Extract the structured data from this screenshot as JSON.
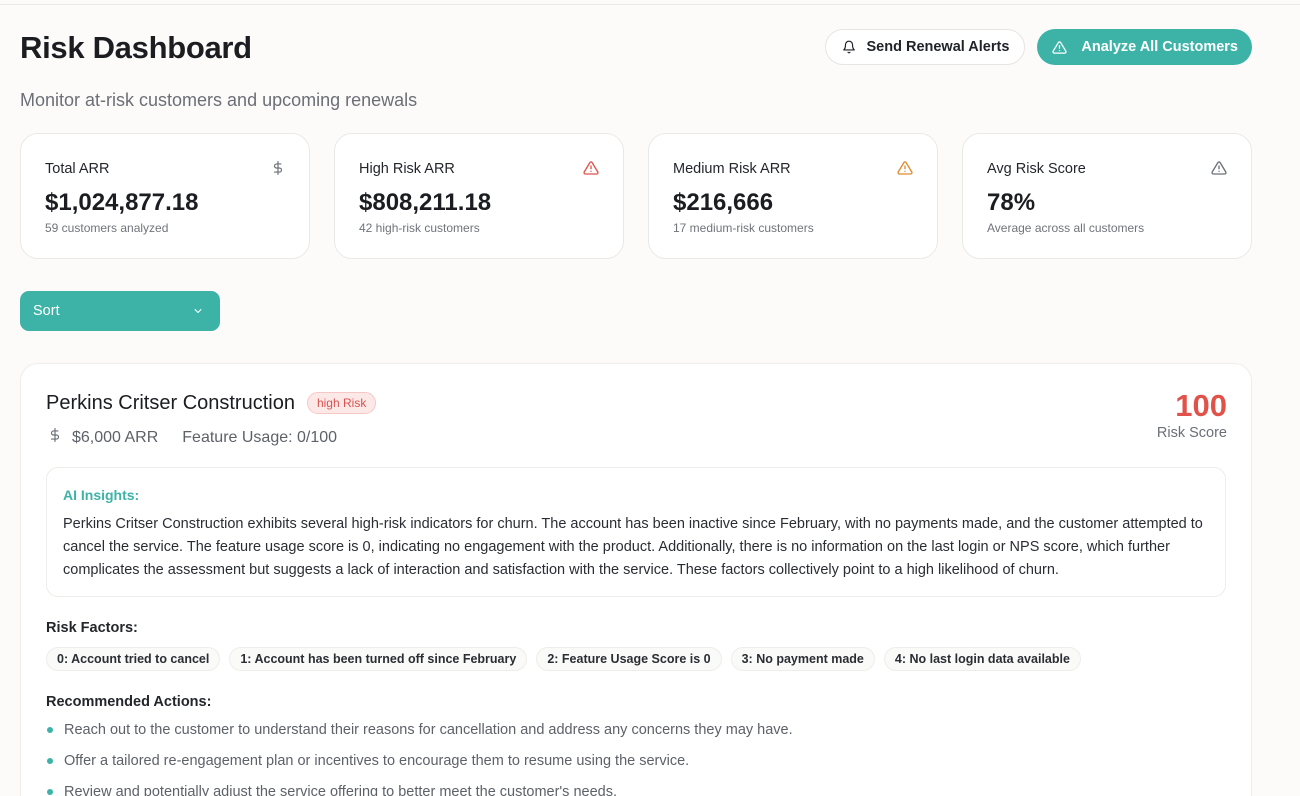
{
  "header": {
    "title": "Risk Dashboard",
    "subtitle": "Monitor at-risk customers and upcoming renewals",
    "send_alerts_label": "Send Renewal Alerts",
    "analyze_label": "Analyze All Customers"
  },
  "stats": [
    {
      "label": "Total ARR",
      "value": "$1,024,877.18",
      "sub": "59 customers analyzed",
      "icon": "dollar-icon"
    },
    {
      "label": "High Risk ARR",
      "value": "$808,211.18",
      "sub": "42 high-risk customers",
      "icon": "alert-triangle-icon",
      "color": "#e0524a"
    },
    {
      "label": "Medium Risk ARR",
      "value": "$216,666",
      "sub": "17 medium-risk customers",
      "icon": "alert-triangle-icon",
      "color": "#e08a2e"
    },
    {
      "label": "Avg Risk Score",
      "value": "78%",
      "sub": "Average across all customers",
      "icon": "alert-triangle-icon",
      "color": "#6b6f76"
    }
  ],
  "sort": {
    "label": "Sort"
  },
  "customer": {
    "name": "Perkins Critser Construction",
    "risk_badge": "high Risk",
    "arr": "$6,000 ARR",
    "feature_usage": "Feature Usage: 0/100",
    "risk_score": "100",
    "risk_score_label": "Risk Score",
    "insights_title": "AI Insights:",
    "insights_text": "Perkins Critser Construction exhibits several high-risk indicators for churn. The account has been inactive since February, with no payments made, and the customer attempted to cancel the service. The feature usage score is 0, indicating no engagement with the product. Additionally, there is no information on the last login or NPS score, which further complicates the assessment but suggests a lack of interaction and satisfaction with the service. These factors collectively point to a high likelihood of churn.",
    "risk_factors_title": "Risk Factors:",
    "risk_factors": [
      "0: Account tried to cancel",
      "1: Account has been turned off since February",
      "2: Feature Usage Score is 0",
      "3: No payment made",
      "4: No last login data available"
    ],
    "actions_title": "Recommended Actions:",
    "actions": [
      "Reach out to the customer to understand their reasons for cancellation and address any concerns they may have.",
      "Offer a tailored re-engagement plan or incentives to encourage them to resume using the service.",
      "Review and potentially adjust the service offering to better meet the customer's needs."
    ]
  },
  "colors": {
    "accent": "#3db3a8",
    "danger": "#e0524a",
    "warning": "#e08a2e"
  }
}
